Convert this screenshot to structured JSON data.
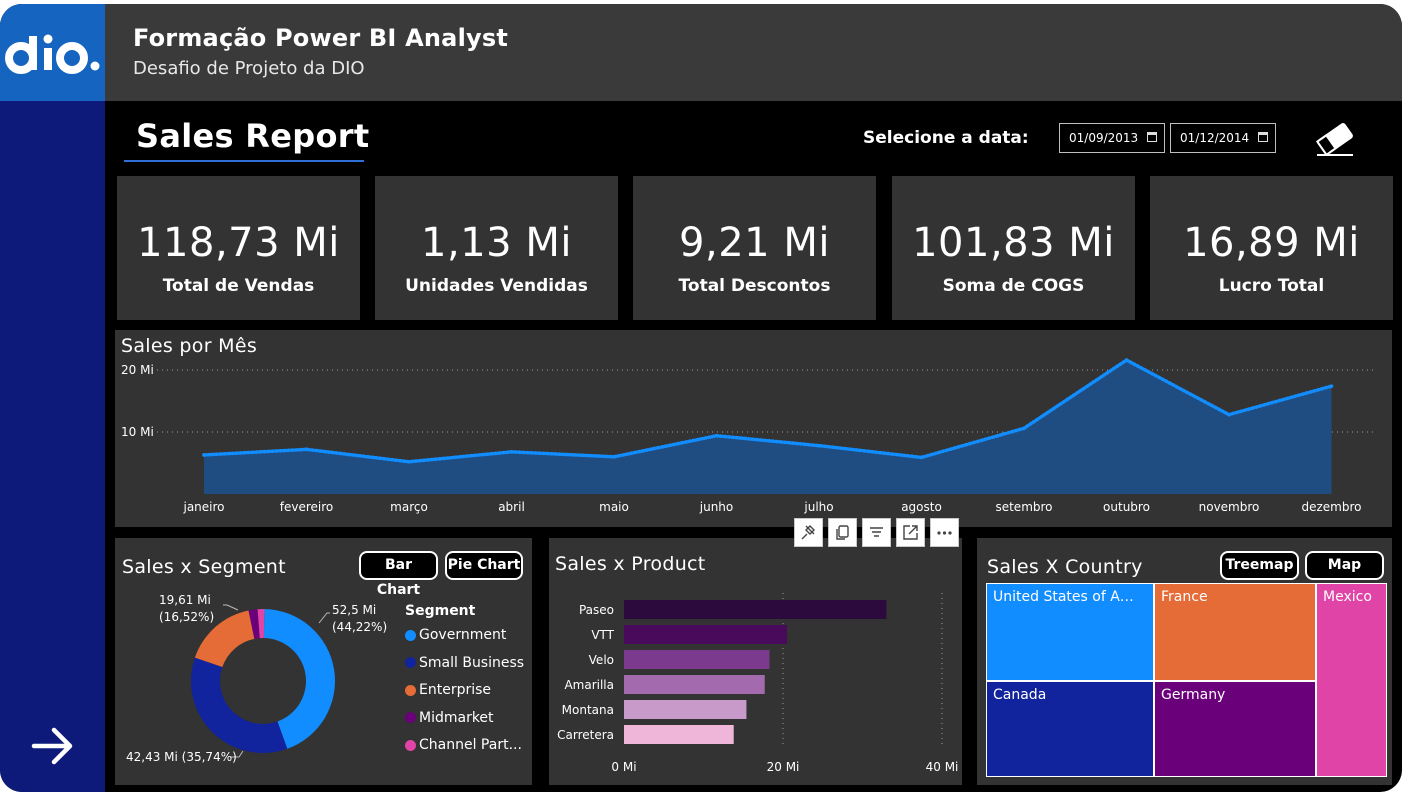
{
  "header": {
    "title": "Formação Power BI Analyst",
    "subtitle": "Desafio de Projeto da DIO"
  },
  "report": {
    "title": "Sales Report",
    "date_label": "Selecione a data:",
    "start_date": "01/09/2013",
    "end_date": "01/12/2014"
  },
  "icons": {
    "logo": "dio-logo",
    "eraser": "eraser-icon",
    "next": "arrow-right-icon",
    "calendar": "calendar-icon"
  },
  "kpis": [
    {
      "value": "118,73 Mi",
      "label": "Total de Vendas"
    },
    {
      "value": "1,13 Mi",
      "label": "Unidades Vendidas"
    },
    {
      "value": "9,21 Mi",
      "label": "Total Descontos"
    },
    {
      "value": "101,83 Mi",
      "label": "Soma de COGS"
    },
    {
      "value": "16,89 Mi",
      "label": "Lucro Total"
    }
  ],
  "sales_month": {
    "title": "Sales por Mês",
    "y_ticks": [
      "20 Mi",
      "10 Mi"
    ]
  },
  "segment": {
    "title": "Sales x Segment",
    "buttons": [
      "Bar Chart",
      "Pie Chart"
    ],
    "legend_title": "Segment",
    "labels": {
      "government": [
        "52,5 Mi",
        "(44,22%)"
      ],
      "enterprise": [
        "19,61 Mi",
        "(16,52%)"
      ],
      "small_business": "42,43 Mi (35,74%)"
    }
  },
  "product": {
    "title": "Sales x Product",
    "x_ticks": [
      "0 Mi",
      "20 Mi",
      "40 Mi"
    ]
  },
  "country": {
    "title": "Sales X Country",
    "buttons": [
      "Treemap",
      "Map Chart"
    ],
    "cells": [
      {
        "label": "United States of America",
        "color": "#118dff"
      },
      {
        "label": "France",
        "color": "#e66c37"
      },
      {
        "label": "Mexico",
        "color": "#e044a7"
      },
      {
        "label": "Canada",
        "color": "#12239e"
      },
      {
        "label": "Germany",
        "color": "#6b007b"
      }
    ]
  },
  "colors": {
    "accent": "#118dff",
    "sidebar": "#0e1a7a",
    "logo_bg": "#1565c0",
    "panel": "#333333"
  },
  "chart_data": [
    {
      "type": "area",
      "title": "Sales por Mês",
      "categories": [
        "janeiro",
        "fevereiro",
        "março",
        "abril",
        "maio",
        "junho",
        "julho",
        "agosto",
        "setembro",
        "outubro",
        "novembro",
        "dezembro"
      ],
      "values": [
        6.3,
        7.2,
        5.2,
        6.8,
        6.0,
        9.4,
        7.8,
        5.9,
        10.6,
        21.6,
        12.8,
        17.4
      ],
      "ylim": [
        0,
        25
      ],
      "ylabel": "",
      "color": "#118dff",
      "grid": true
    },
    {
      "type": "pie",
      "title": "Sales x Segment",
      "categories": [
        "Government",
        "Small Business",
        "Enterprise",
        "Midmarket",
        "Channel Partners"
      ],
      "values": [
        52.5,
        42.43,
        19.61,
        2.4,
        1.8
      ],
      "colors": [
        "#118dff",
        "#12239e",
        "#e66c37",
        "#6b007b",
        "#e044a7"
      ],
      "legend": "right"
    },
    {
      "type": "bar",
      "title": "Sales x Product",
      "orientation": "horizontal",
      "categories": [
        "Paseo",
        "VTT",
        "Velo",
        "Amarilla",
        "Montana",
        "Carretera"
      ],
      "values": [
        33.0,
        20.5,
        18.3,
        17.7,
        15.4,
        13.8
      ],
      "colors": [
        "#2d0a3e",
        "#4a0a5c",
        "#7c3a8f",
        "#a36aad",
        "#c79ac9",
        "#f0b6da"
      ],
      "xlim": [
        0,
        40
      ]
    },
    {
      "type": "treemap",
      "title": "Sales X Country",
      "categories": [
        "United States of America",
        "France",
        "Mexico",
        "Canada",
        "Germany"
      ],
      "colors": [
        "#118dff",
        "#e66c37",
        "#e044a7",
        "#12239e",
        "#6b007b"
      ]
    }
  ]
}
